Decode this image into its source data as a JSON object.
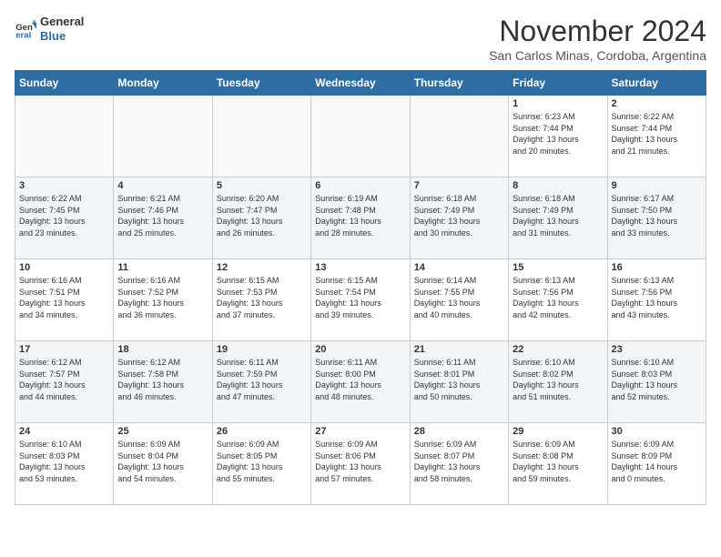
{
  "header": {
    "logo_line1": "General",
    "logo_line2": "Blue",
    "month": "November 2024",
    "location": "San Carlos Minas, Cordoba, Argentina"
  },
  "weekdays": [
    "Sunday",
    "Monday",
    "Tuesday",
    "Wednesday",
    "Thursday",
    "Friday",
    "Saturday"
  ],
  "weeks": [
    [
      {
        "day": "",
        "info": ""
      },
      {
        "day": "",
        "info": ""
      },
      {
        "day": "",
        "info": ""
      },
      {
        "day": "",
        "info": ""
      },
      {
        "day": "",
        "info": ""
      },
      {
        "day": "1",
        "info": "Sunrise: 6:23 AM\nSunset: 7:44 PM\nDaylight: 13 hours\nand 20 minutes."
      },
      {
        "day": "2",
        "info": "Sunrise: 6:22 AM\nSunset: 7:44 PM\nDaylight: 13 hours\nand 21 minutes."
      }
    ],
    [
      {
        "day": "3",
        "info": "Sunrise: 6:22 AM\nSunset: 7:45 PM\nDaylight: 13 hours\nand 23 minutes."
      },
      {
        "day": "4",
        "info": "Sunrise: 6:21 AM\nSunset: 7:46 PM\nDaylight: 13 hours\nand 25 minutes."
      },
      {
        "day": "5",
        "info": "Sunrise: 6:20 AM\nSunset: 7:47 PM\nDaylight: 13 hours\nand 26 minutes."
      },
      {
        "day": "6",
        "info": "Sunrise: 6:19 AM\nSunset: 7:48 PM\nDaylight: 13 hours\nand 28 minutes."
      },
      {
        "day": "7",
        "info": "Sunrise: 6:18 AM\nSunset: 7:49 PM\nDaylight: 13 hours\nand 30 minutes."
      },
      {
        "day": "8",
        "info": "Sunrise: 6:18 AM\nSunset: 7:49 PM\nDaylight: 13 hours\nand 31 minutes."
      },
      {
        "day": "9",
        "info": "Sunrise: 6:17 AM\nSunset: 7:50 PM\nDaylight: 13 hours\nand 33 minutes."
      }
    ],
    [
      {
        "day": "10",
        "info": "Sunrise: 6:16 AM\nSunset: 7:51 PM\nDaylight: 13 hours\nand 34 minutes."
      },
      {
        "day": "11",
        "info": "Sunrise: 6:16 AM\nSunset: 7:52 PM\nDaylight: 13 hours\nand 36 minutes."
      },
      {
        "day": "12",
        "info": "Sunrise: 6:15 AM\nSunset: 7:53 PM\nDaylight: 13 hours\nand 37 minutes."
      },
      {
        "day": "13",
        "info": "Sunrise: 6:15 AM\nSunset: 7:54 PM\nDaylight: 13 hours\nand 39 minutes."
      },
      {
        "day": "14",
        "info": "Sunrise: 6:14 AM\nSunset: 7:55 PM\nDaylight: 13 hours\nand 40 minutes."
      },
      {
        "day": "15",
        "info": "Sunrise: 6:13 AM\nSunset: 7:56 PM\nDaylight: 13 hours\nand 42 minutes."
      },
      {
        "day": "16",
        "info": "Sunrise: 6:13 AM\nSunset: 7:56 PM\nDaylight: 13 hours\nand 43 minutes."
      }
    ],
    [
      {
        "day": "17",
        "info": "Sunrise: 6:12 AM\nSunset: 7:57 PM\nDaylight: 13 hours\nand 44 minutes."
      },
      {
        "day": "18",
        "info": "Sunrise: 6:12 AM\nSunset: 7:58 PM\nDaylight: 13 hours\nand 46 minutes."
      },
      {
        "day": "19",
        "info": "Sunrise: 6:11 AM\nSunset: 7:59 PM\nDaylight: 13 hours\nand 47 minutes."
      },
      {
        "day": "20",
        "info": "Sunrise: 6:11 AM\nSunset: 8:00 PM\nDaylight: 13 hours\nand 48 minutes."
      },
      {
        "day": "21",
        "info": "Sunrise: 6:11 AM\nSunset: 8:01 PM\nDaylight: 13 hours\nand 50 minutes."
      },
      {
        "day": "22",
        "info": "Sunrise: 6:10 AM\nSunset: 8:02 PM\nDaylight: 13 hours\nand 51 minutes."
      },
      {
        "day": "23",
        "info": "Sunrise: 6:10 AM\nSunset: 8:03 PM\nDaylight: 13 hours\nand 52 minutes."
      }
    ],
    [
      {
        "day": "24",
        "info": "Sunrise: 6:10 AM\nSunset: 8:03 PM\nDaylight: 13 hours\nand 53 minutes."
      },
      {
        "day": "25",
        "info": "Sunrise: 6:09 AM\nSunset: 8:04 PM\nDaylight: 13 hours\nand 54 minutes."
      },
      {
        "day": "26",
        "info": "Sunrise: 6:09 AM\nSunset: 8:05 PM\nDaylight: 13 hours\nand 55 minutes."
      },
      {
        "day": "27",
        "info": "Sunrise: 6:09 AM\nSunset: 8:06 PM\nDaylight: 13 hours\nand 57 minutes."
      },
      {
        "day": "28",
        "info": "Sunrise: 6:09 AM\nSunset: 8:07 PM\nDaylight: 13 hours\nand 58 minutes."
      },
      {
        "day": "29",
        "info": "Sunrise: 6:09 AM\nSunset: 8:08 PM\nDaylight: 13 hours\nand 59 minutes."
      },
      {
        "day": "30",
        "info": "Sunrise: 6:09 AM\nSunset: 8:09 PM\nDaylight: 14 hours\nand 0 minutes."
      }
    ]
  ]
}
